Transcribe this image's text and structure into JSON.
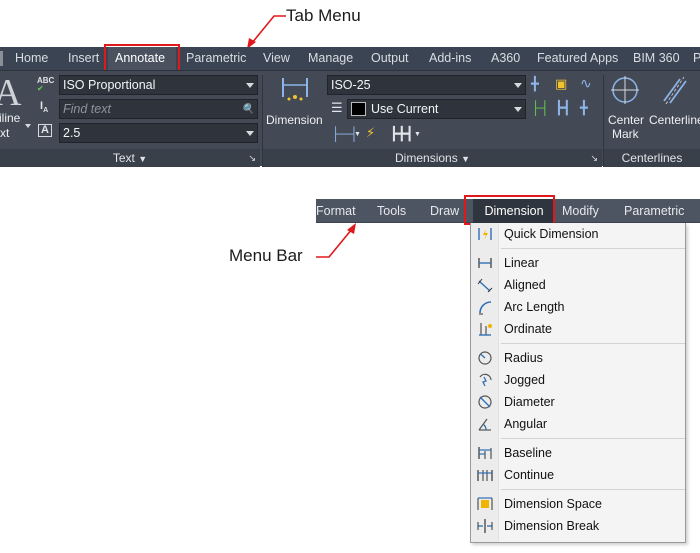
{
  "callouts": {
    "tab_menu": "Tab Menu",
    "menu_bar": "Menu Bar"
  },
  "ribbon": {
    "tabs": [
      {
        "label": "Home"
      },
      {
        "label": "Insert"
      },
      {
        "label": "Annotate",
        "active": true
      },
      {
        "label": "Parametric"
      },
      {
        "label": "View"
      },
      {
        "label": "Manage"
      },
      {
        "label": "Output"
      },
      {
        "label": "Add-ins"
      },
      {
        "label": "A360"
      },
      {
        "label": "Featured Apps"
      },
      {
        "label": "BIM 360"
      },
      {
        "label": "P"
      }
    ],
    "text_panel": {
      "title": "Text",
      "big_button_lines": [
        "iline",
        "xt"
      ],
      "text_style": "ISO Proportional",
      "find_placeholder": "Find text",
      "text_height": "2.5"
    },
    "dimensions_panel": {
      "title": "Dimensions",
      "dimension_button": "Dimension",
      "dim_style": "ISO-25",
      "layer": "Use Current"
    },
    "centerlines_panel": {
      "title": "Centerlines",
      "center_mark_lines": [
        "Center",
        "Mark"
      ],
      "centerline": "Centerline"
    }
  },
  "menubar": {
    "items": [
      {
        "label": "Format"
      },
      {
        "label": "Tools"
      },
      {
        "label": "Draw"
      },
      {
        "label": "Dimension",
        "active": true
      },
      {
        "label": "Modify"
      },
      {
        "label": "Parametric"
      }
    ]
  },
  "dimension_menu": {
    "groups": [
      [
        {
          "label": "Quick Dimension",
          "icon": "quick-dimension-icon"
        }
      ],
      [
        {
          "label": "Linear",
          "icon": "linear-icon"
        },
        {
          "label": "Aligned",
          "icon": "aligned-icon"
        },
        {
          "label": "Arc Length",
          "icon": "arc-length-icon"
        },
        {
          "label": "Ordinate",
          "icon": "ordinate-icon"
        }
      ],
      [
        {
          "label": "Radius",
          "icon": "radius-icon"
        },
        {
          "label": "Jogged",
          "icon": "jogged-icon"
        },
        {
          "label": "Diameter",
          "icon": "diameter-icon"
        },
        {
          "label": "Angular",
          "icon": "angular-icon"
        }
      ],
      [
        {
          "label": "Baseline",
          "icon": "baseline-icon"
        },
        {
          "label": "Continue",
          "icon": "continue-icon"
        }
      ],
      [
        {
          "label": "Dimension Space",
          "icon": "dimension-space-icon"
        },
        {
          "label": "Dimension Break",
          "icon": "dimension-break-icon"
        }
      ]
    ]
  },
  "colors": {
    "highlight": "#e0181b",
    "ribbon_tabbar": "#3b4452",
    "ribbon_panel": "#444a55",
    "menubar": "#4d5562"
  }
}
